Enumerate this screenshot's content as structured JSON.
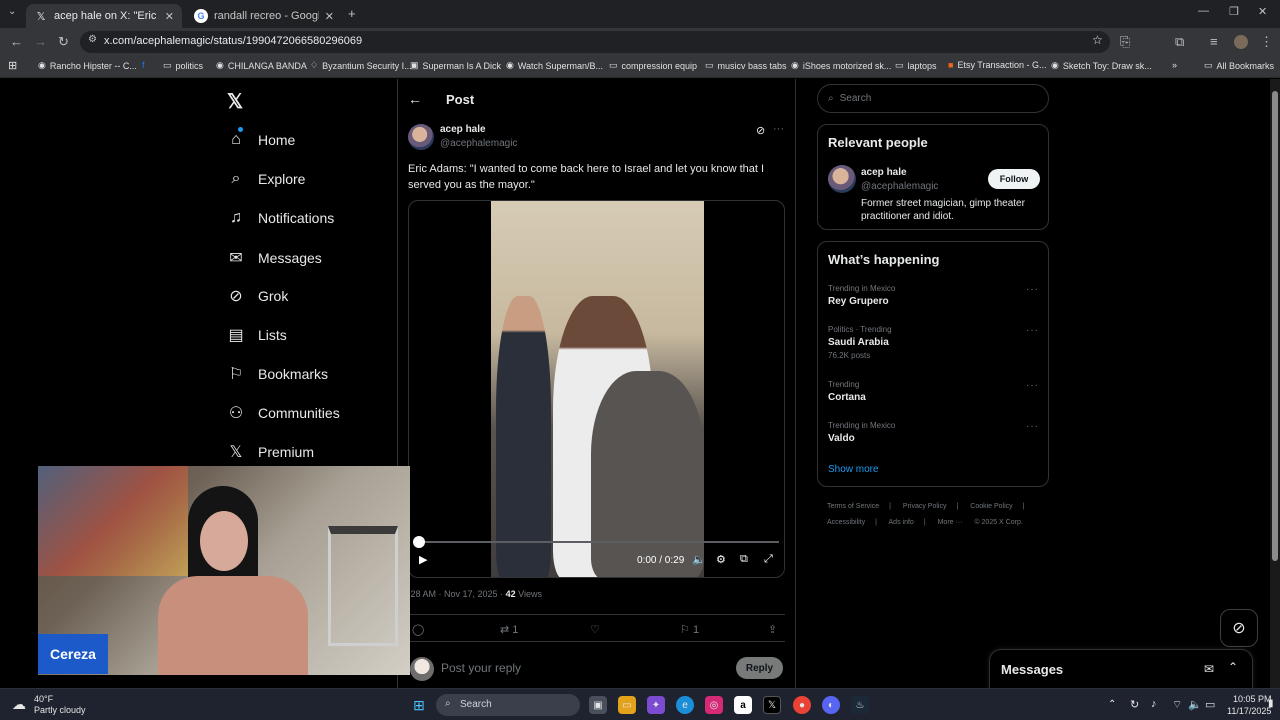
{
  "browser": {
    "tabs": [
      {
        "title": "acep hale on X: \"Eric Adams: \"I",
        "icon": "x-logo-icon"
      },
      {
        "title": "randall recreo - Google Search",
        "icon": "google-icon"
      }
    ],
    "url": "x.com/acephalemagic/status/1990472066580296069",
    "bookmarks": [
      "Rancho Hipster -- C...",
      "politics",
      "CHILANGA BANDA",
      "Byzantium Security I...",
      "Superman Is A Dick",
      "Watch Superman/B...",
      "compression equip",
      "musicv bass tabs",
      "iShoes motorized sk...",
      "laptops",
      "Etsy Transaction - G...",
      "Sketch Toy: Draw sk..."
    ],
    "all_bookmarks": "All Bookmarks"
  },
  "nav": {
    "items": [
      "Home",
      "Explore",
      "Notifications",
      "Messages",
      "Grok",
      "Lists",
      "Bookmarks",
      "Communities",
      "Premium"
    ]
  },
  "post": {
    "header": "Post",
    "author_name": "acep hale",
    "author_handle": "@acephalemagic",
    "text": "Eric Adams: \"I wanted to come back here to Israel and let you know that I served you as the mayor.\"",
    "video_time": "0:00 / 0:29",
    "progress": 0,
    "meta_time": ":28 AM · Nov 17, 2025 ·",
    "views_count": "42",
    "views_label": "Views",
    "retweets": "1",
    "bookmarks": "1",
    "reply_placeholder": "Post your reply",
    "reply_button": "Reply"
  },
  "sidebar": {
    "search_placeholder": "Search",
    "relevant_title": "Relevant people",
    "person_name": "acep hale",
    "person_handle": "@acephalemagic",
    "person_bio": "Former street magician, gimp theater practitioner and idiot.",
    "follow_label": "Follow",
    "happening_title": "What’s happening",
    "trends": [
      {
        "context": "Trending in Mexico",
        "topic": "Rey Grupero",
        "posts": ""
      },
      {
        "context": "Politics · Trending",
        "topic": "Saudi Arabia",
        "posts": "76.2K posts"
      },
      {
        "context": "Trending",
        "topic": "Cortana",
        "posts": ""
      },
      {
        "context": "Trending in Mexico",
        "topic": "Valdo",
        "posts": ""
      }
    ],
    "show_more": "Show more",
    "footer": [
      "Terms of Service",
      "|",
      "Privacy Policy",
      "|",
      "Cookie Policy",
      "|",
      "Accessibility",
      "|",
      "Ads info",
      "|",
      "More ···",
      "© 2025 X Corp."
    ]
  },
  "messages_dock": "Messages",
  "webcam": {
    "name": "Cereza"
  },
  "taskbar": {
    "weather_temp": "40°F",
    "weather_desc": "Partly cloudy",
    "search_placeholder": "Search",
    "time": "10:05 PM",
    "date": "11/17/2025"
  },
  "colors": {
    "accent": "#1d9bf0",
    "webcam_label": "#1c59c9"
  }
}
